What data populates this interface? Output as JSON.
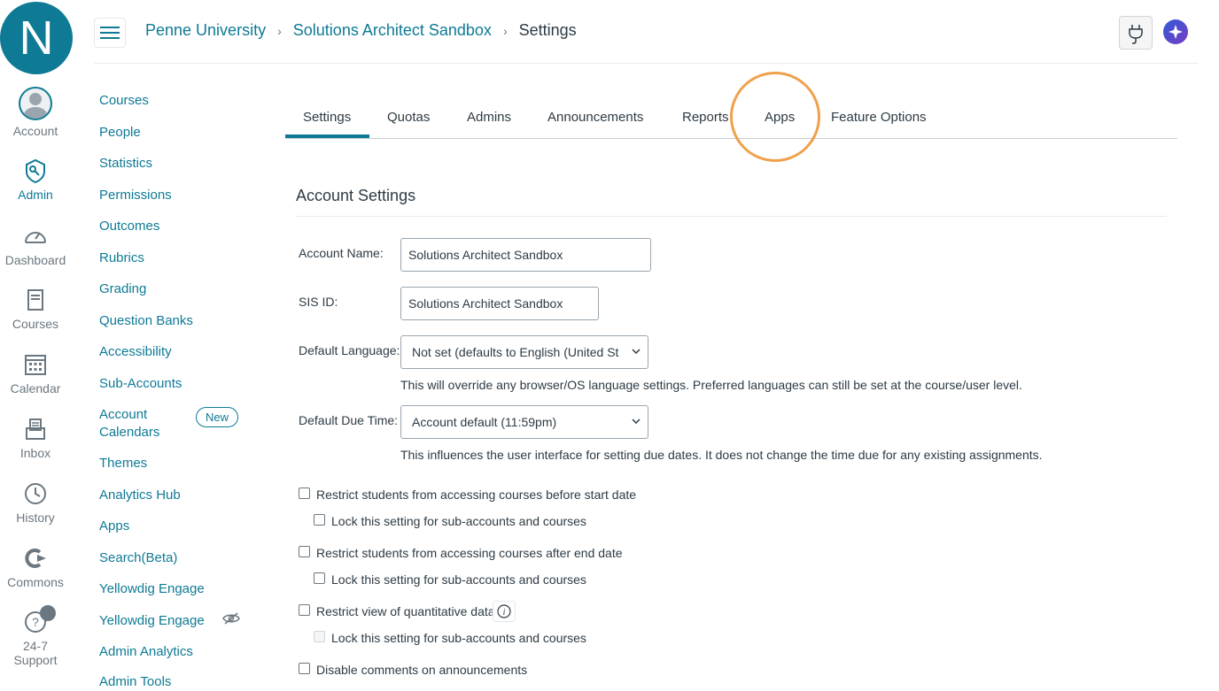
{
  "global_nav": {
    "logo_letter": "N",
    "items": [
      {
        "label": "Account",
        "icon": "avatar-icon"
      },
      {
        "label": "Admin",
        "icon": "shield-icon"
      },
      {
        "label": "Dashboard",
        "icon": "dashboard-icon"
      },
      {
        "label": "Courses",
        "icon": "book-icon"
      },
      {
        "label": "Calendar",
        "icon": "calendar-icon"
      },
      {
        "label": "Inbox",
        "icon": "inbox-icon"
      },
      {
        "label": "History",
        "icon": "clock-icon"
      },
      {
        "label": "Commons",
        "icon": "commons-icon"
      },
      {
        "label": "24-7 Support",
        "icon": "help-icon"
      }
    ]
  },
  "header": {
    "breadcrumbs": [
      "Penne University",
      "Solutions Architect Sandbox",
      "Settings"
    ]
  },
  "course_nav": {
    "items": [
      "Courses",
      "People",
      "Statistics",
      "Permissions",
      "Outcomes",
      "Rubrics",
      "Grading",
      "Question Banks",
      "Accessibility",
      "Sub-Accounts",
      "Account Calendars",
      "Themes",
      "Analytics Hub",
      "Apps",
      "Search(Beta)",
      "Yellowdig Engage",
      "Yellowdig Engage",
      "Admin Analytics",
      "Admin Tools"
    ],
    "new_badge": "New"
  },
  "tabs": [
    "Settings",
    "Quotas",
    "Admins",
    "Announcements",
    "Reports",
    "Apps",
    "Feature Options"
  ],
  "form": {
    "section_title": "Account Settings",
    "account_name_label": "Account Name:",
    "account_name_value": "Solutions Architect Sandbox",
    "sis_id_label": "SIS ID:",
    "sis_id_value": "Solutions Architect Sandbox",
    "default_language_label": "Default Language:",
    "default_language_value": "Not set (defaults to English (United St",
    "default_language_help": "This will override any browser/OS language settings. Preferred languages can still be set at the course/user level.",
    "default_due_time_label": "Default Due Time:",
    "default_due_time_value": "Account default (11:59pm)",
    "default_due_time_help": "This influences the user interface for setting due dates. It does not change the time due for any existing assignments.",
    "checkboxes": [
      "Restrict students from accessing courses before start date",
      "Lock this setting for sub-accounts and courses",
      "Restrict students from accessing courses after end date",
      "Lock this setting for sub-accounts and courses",
      "Restrict view of quantitative data",
      "Lock this setting for sub-accounts and courses",
      "Disable comments on announcements"
    ]
  },
  "colors": {
    "brand": "#0e7a95",
    "highlight": "#f0a04b"
  }
}
